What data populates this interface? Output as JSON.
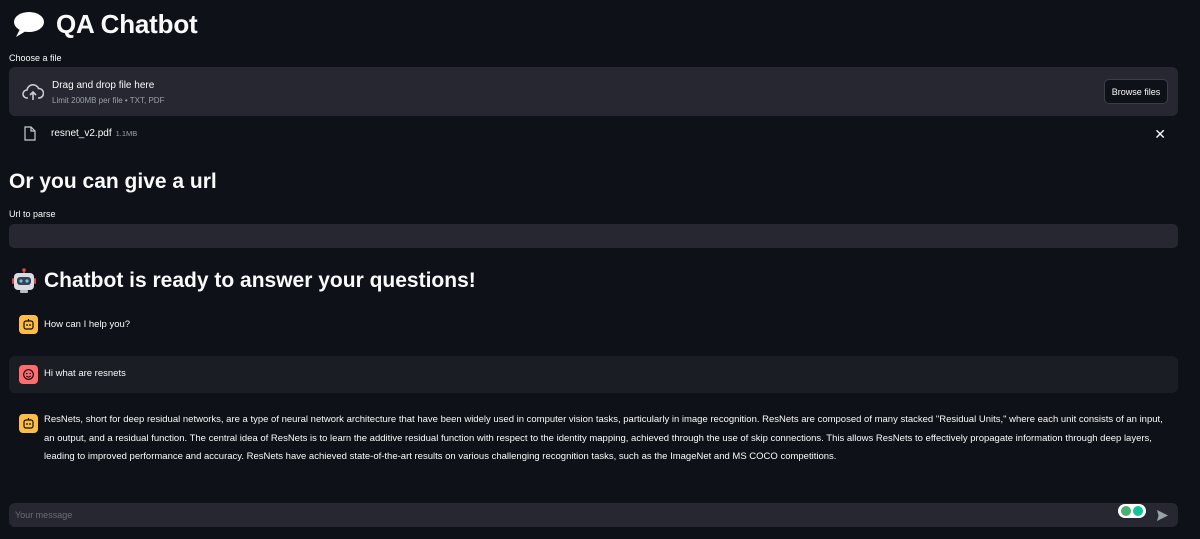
{
  "app": {
    "title": "QA Chatbot"
  },
  "upload": {
    "label": "Choose a file",
    "drop_text": "Drag and drop file here",
    "limit_text": "Limit 200MB per file • TXT, PDF",
    "browse_label": "Browse files",
    "file": {
      "name": "resnet_v2.pdf",
      "size": "1.1MB"
    },
    "remove_glyph": "✕"
  },
  "url_section": {
    "heading": "Or you can give a url",
    "label": "Url to parse",
    "value": ""
  },
  "chat": {
    "heading": "Chatbot is ready to answer your questions!",
    "messages": [
      {
        "role": "assistant",
        "text": "How can I help you?"
      },
      {
        "role": "user",
        "text": "Hi what are resnets"
      },
      {
        "role": "assistant",
        "text": "ResNets, short for deep residual networks, are a type of neural network architecture that have been widely used in computer vision tasks, particularly in image recognition. ResNets are composed of many stacked \"Residual Units,\" where each unit consists of an input, an output, and a residual function. The central idea of ResNets is to learn the additive residual function with respect to the identity mapping, achieved through the use of skip connections. This allows ResNets to effectively propagate information through deep layers, leading to improved performance and accuracy. ResNets have achieved state-of-the-art results on various challenging recognition tasks, such as the ImageNet and MS COCO competitions."
      }
    ],
    "input_placeholder": "Your message"
  },
  "icons": {
    "title_icon": "speech-bubble-icon",
    "upload_icon": "cloud-upload-icon",
    "file_icon": "document-icon",
    "heading_icon": "robot-icon",
    "assistant_avatar": "robot-face-icon",
    "user_avatar": "smiley-face-icon",
    "send_icon": "send-arrow-icon"
  },
  "colors": {
    "background": "#0e1117",
    "panel": "#262730",
    "assistant_avatar": "#ffbd45",
    "user_avatar": "#ff6c6c",
    "muted_text": "#9aa0aa"
  }
}
